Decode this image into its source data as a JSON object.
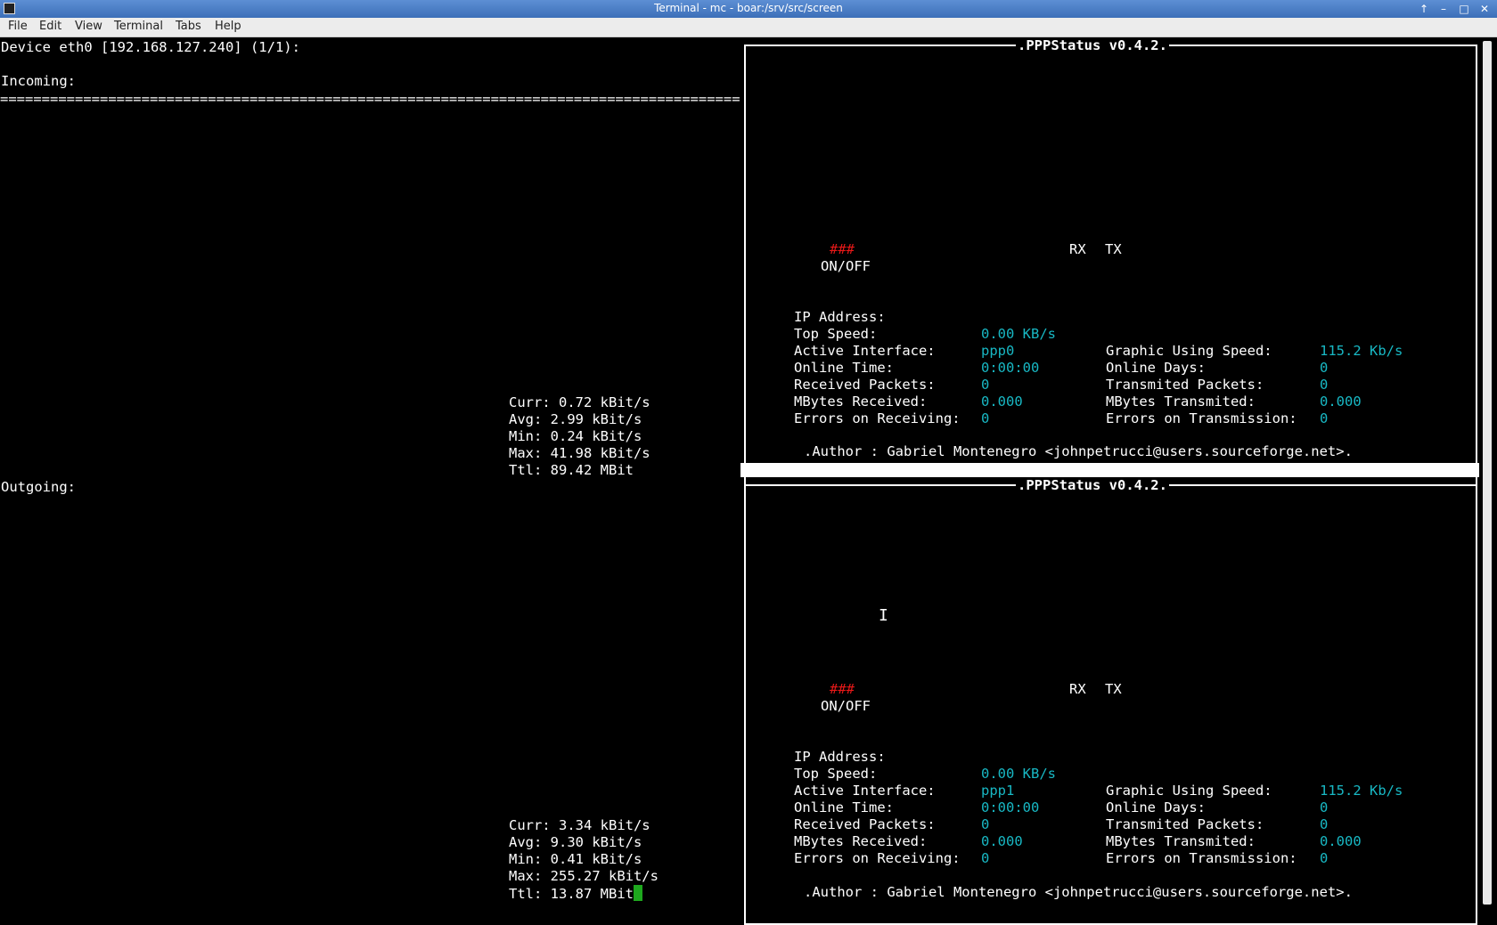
{
  "window": {
    "title": "Terminal - mc - boar:/srv/src/screen",
    "controls": {
      "up": "↑",
      "minimize": "–",
      "maximize": "□",
      "close": "✕"
    }
  },
  "menu": [
    "File",
    "Edit",
    "View",
    "Terminal",
    "Tabs",
    "Help"
  ],
  "nload": {
    "device_line": "Device eth0 [192.168.127.240] (1/1):",
    "separator": "=============================================================================================================",
    "incoming": {
      "label": "Incoming:",
      "stats": [
        "Curr: 0.72 kBit/s",
        "Avg: 2.99 kBit/s",
        "Min: 0.24 kBit/s",
        "Max: 41.98 kBit/s",
        "Ttl: 89.42 MBit"
      ]
    },
    "outgoing": {
      "label": "Outgoing:",
      "stats": [
        "Curr: 3.34 kBit/s",
        "Avg: 9.30 kBit/s",
        "Min: 0.41 kBit/s",
        "Max: 255.27 kBit/s",
        "Ttl: 13.87 MBit"
      ]
    }
  },
  "pppstatus": [
    {
      "title": ".PPPStatus v0.4.2.",
      "led": "###",
      "onoff": "ON/OFF",
      "rx": "RX",
      "tx": "TX",
      "ip_label": "IP Address:",
      "top_speed_label": "Top Speed:",
      "top_speed": "0.00 KB/s",
      "iface_label": "Active Interface:",
      "iface": "ppp0",
      "gspeed_label": "Graphic Using Speed:",
      "gspeed": "115.2 Kb/s",
      "online_time_label": "Online Time:",
      "online_time": "0:00:00",
      "online_days_label": "Online Days:",
      "online_days": "0",
      "rx_packets_label": "Received Packets:",
      "rx_packets": "0",
      "tx_packets_label": "Transmited Packets:",
      "tx_packets": "0",
      "mb_rx_label": "MBytes Received:",
      "mb_rx": "0.000",
      "mb_tx_label": "MBytes Transmited:",
      "mb_tx": "0.000",
      "err_rx_label": "Errors on Receiving:",
      "err_rx": "0",
      "err_tx_label": "Errors on Transmission:",
      "err_tx": "0",
      "author": ".Author : Gabriel Montenegro <johnpetrucci@users.sourceforge.net>."
    },
    {
      "title": ".PPPStatus v0.4.2.",
      "led": "###",
      "onoff": "ON/OFF",
      "rx": "RX",
      "tx": "TX",
      "ip_label": "IP Address:",
      "top_speed_label": "Top Speed:",
      "top_speed": "0.00 KB/s",
      "iface_label": "Active Interface:",
      "iface": "ppp1",
      "gspeed_label": "Graphic Using Speed:",
      "gspeed": "115.2 Kb/s",
      "online_time_label": "Online Time:",
      "online_time": "0:00:00",
      "online_days_label": "Online Days:",
      "online_days": "0",
      "rx_packets_label": "Received Packets:",
      "rx_packets": "0",
      "tx_packets_label": "Transmited Packets:",
      "tx_packets": "0",
      "mb_rx_label": "MBytes Received:",
      "mb_rx": "0.000",
      "mb_tx_label": "MBytes Transmited:",
      "mb_tx": "0.000",
      "err_rx_label": "Errors on Receiving:",
      "err_rx": "0",
      "err_tx_label": "Errors on Transmission:",
      "err_tx": "0",
      "author": ".Author : Gabriel Montenegro <johnpetrucci@users.sourceforge.net>."
    }
  ],
  "colors": {
    "value": "#18b8c4",
    "led": "#e81818",
    "cursor": "#1ea81e",
    "titlebar": "#4a7ec6"
  }
}
